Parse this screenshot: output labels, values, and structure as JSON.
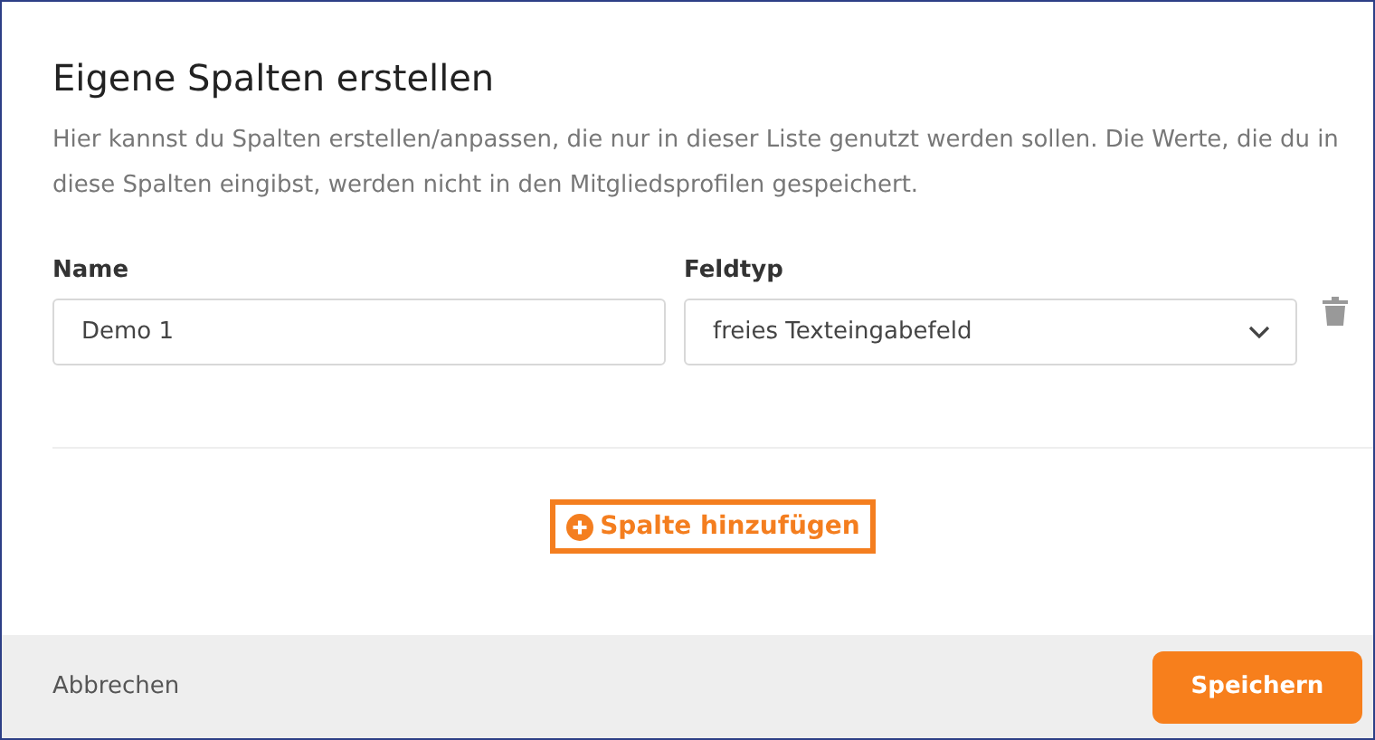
{
  "dialog": {
    "title": "Eigene Spalten erstellen",
    "description": "Hier kannst du Spalten erstellen/anpassen, die nur in dieser Liste genutzt werden sollen. Die Werte, die du in diese Spalten eingibst, werden nicht in den Mitgliedsprofilen gespeichert."
  },
  "columns": [
    {
      "name_label": "Name",
      "name_value": "Demo 1",
      "type_label": "Feldtyp",
      "type_value": "freies Texteingabefeld"
    }
  ],
  "add_button": "Spalte hinzufügen",
  "footer": {
    "cancel": "Abbrechen",
    "save": "Speichern"
  }
}
